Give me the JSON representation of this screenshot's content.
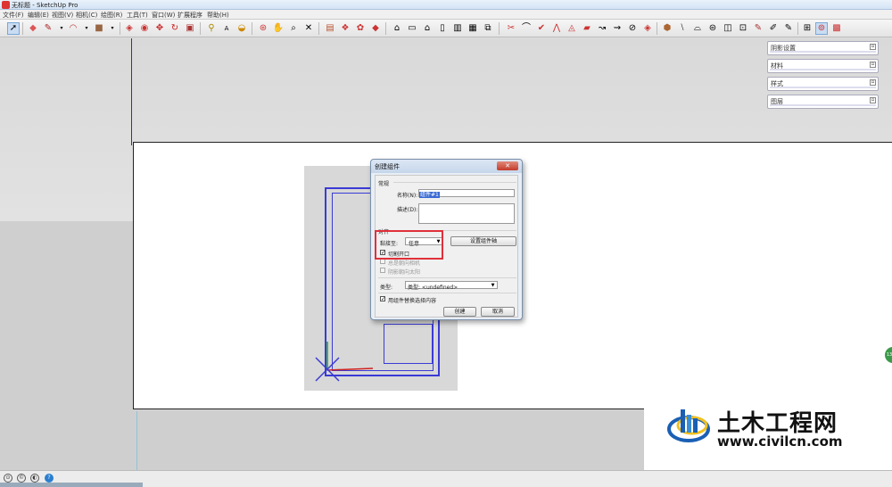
{
  "window": {
    "title": "无标题 - SketchUp Pro"
  },
  "menu": [
    "文件(F)",
    "编辑(E)",
    "视图(V)",
    "相机(C)",
    "绘图(R)",
    "工具(T)",
    "窗口(W)",
    "扩展程序",
    "帮助(H)"
  ],
  "toolbar": {
    "icons": [
      "select-icon",
      "eraser-icon",
      "pencil-icon",
      "arc-icon",
      "rectangle-icon",
      "push-pull-icon",
      "follow-me-icon",
      "move-icon",
      "rotate-icon",
      "offset-icon",
      "tape-icon",
      "text-icon",
      "paint-icon",
      "orbit-icon",
      "pan-icon",
      "zoom-icon",
      "zoom-extents-icon",
      "warehouse-icon",
      "components-icon",
      "extensions-icon",
      "iso-view-icon",
      "top-view-icon",
      "front-view-icon",
      "right-view-icon",
      "back-view-icon",
      "left-view-icon",
      "xray-icon",
      "section-icon",
      "arc2-icon",
      "polygon-icon",
      "freehand-icon",
      "sandbox-icon",
      "layers-icon",
      "styles-icon",
      "shadow-icon",
      "fog-icon",
      "match-photo-icon",
      "dimension-icon",
      "axes-icon",
      "protractor-icon",
      "walk-icon",
      "lookaround-icon",
      "position-camera-icon",
      "ruby-icon",
      "materials-icon"
    ]
  },
  "trays": [
    {
      "label": "阴影设置"
    },
    {
      "label": "材料"
    },
    {
      "label": "样式"
    },
    {
      "label": "图层"
    }
  ],
  "dialog": {
    "title": "创建组件",
    "close": "✕",
    "section_general": "常规",
    "name_label": "名称(N):",
    "name_value": "组件#1",
    "desc_label": "描述(D):",
    "section_align": "对齐",
    "glue_label": "黏接至:",
    "glue_value": "任意",
    "set_axes_button": "设置组件轴",
    "cut_opening_label": "切割开口",
    "cut_opening_checked": true,
    "always_face_camera_label": "总是朝向相机",
    "shadows_face_sun_label": "阴影朝向太阳",
    "type_label": "类型:",
    "type_value": "类型: <undefined>",
    "replace_label": "用组件替换选择内容",
    "replace_checked": true,
    "create_button": "创建",
    "cancel_button": "取消"
  },
  "side_badge": "13",
  "watermark": {
    "name": "土木工程网",
    "url": "www.civilcn.com"
  },
  "colors": {
    "highlight": "#e0303a",
    "axis_blue": "#2b2bd0",
    "axis_red": "#d02020",
    "axis_green": "#1fa01f",
    "model_blue": "#3a3ad6"
  }
}
